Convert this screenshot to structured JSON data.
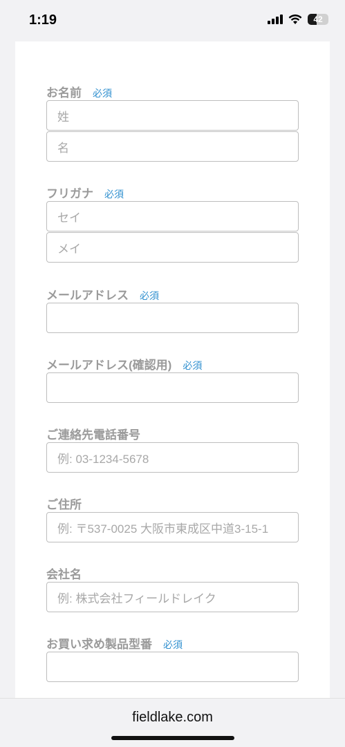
{
  "status": {
    "time": "1:19",
    "battery_percent": "42"
  },
  "form": {
    "name": {
      "label": "お名前",
      "required": "必須",
      "last_placeholder": "姓",
      "first_placeholder": "名"
    },
    "kana": {
      "label": "フリガナ",
      "required": "必須",
      "last_placeholder": "セイ",
      "first_placeholder": "メイ"
    },
    "email": {
      "label": "メールアドレス",
      "required": "必須",
      "value": ""
    },
    "email_confirm": {
      "label": "メールアドレス(確認用)",
      "required": "必須",
      "value": ""
    },
    "phone": {
      "label": "ご連絡先電話番号",
      "placeholder": "例: 03-1234-5678"
    },
    "address": {
      "label": "ご住所",
      "placeholder": "例: 〒537-0025 大阪市東成区中道3-15-1"
    },
    "company": {
      "label": "会社名",
      "placeholder": "例: 株式会社フィールドレイク"
    },
    "model": {
      "label": "お買い求め製品型番",
      "required": "必須",
      "value": ""
    }
  },
  "browser": {
    "url": "fieldlake.com"
  }
}
